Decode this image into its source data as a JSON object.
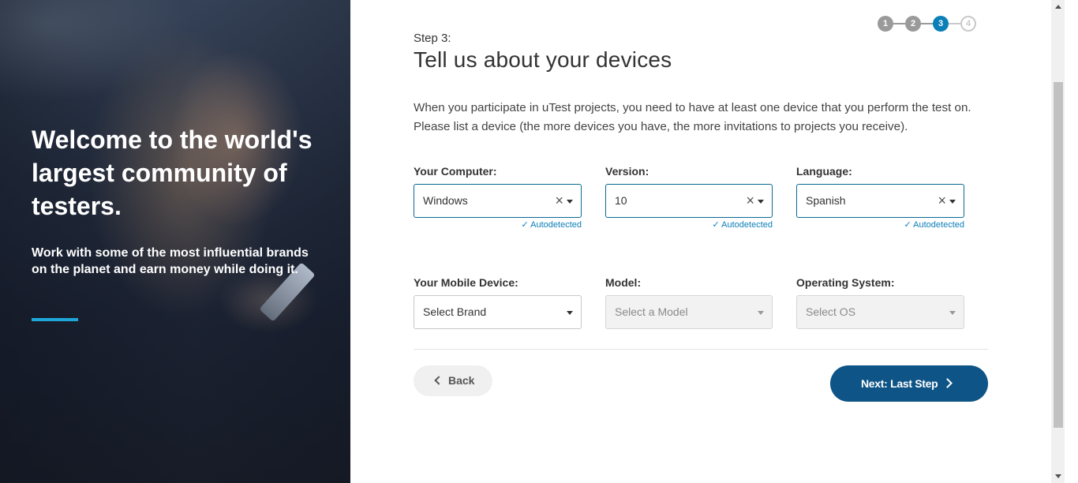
{
  "hero": {
    "title": "Welcome to the world's largest community of testers.",
    "subtitle": "Work with some of the most influential brands on the planet and earn money while doing it."
  },
  "stepper": {
    "steps": [
      "1",
      "2",
      "3",
      "4"
    ],
    "current": 3,
    "colors": {
      "done": "#9a9a9a",
      "current": "#0b7fb8",
      "todo": "#c9c9c9"
    }
  },
  "header": {
    "step_label": "Step 3:",
    "title": "Tell us about your devices",
    "intro": "When you participate in uTest projects, you need to have at least one device that you perform the test on. Please list a device (the more devices you have, the more invitations to projects you receive)."
  },
  "computer": {
    "os_label": "Your Computer:",
    "os_value": "Windows",
    "version_label": "Version:",
    "version_value": "10",
    "language_label": "Language:",
    "language_value": "Spanish",
    "autodetected": "Autodetected"
  },
  "mobile": {
    "brand_label": "Your Mobile Device:",
    "brand_placeholder": "Select Brand",
    "model_label": "Model:",
    "model_placeholder": "Select a Model",
    "os_label": "Operating System:",
    "os_placeholder": "Select OS"
  },
  "actions": {
    "back_label": "Back",
    "next_label": "Next: Last Step"
  },
  "colors": {
    "primary": "#0e5486",
    "accent": "#1ea6d9",
    "link": "#0b7fb8"
  }
}
